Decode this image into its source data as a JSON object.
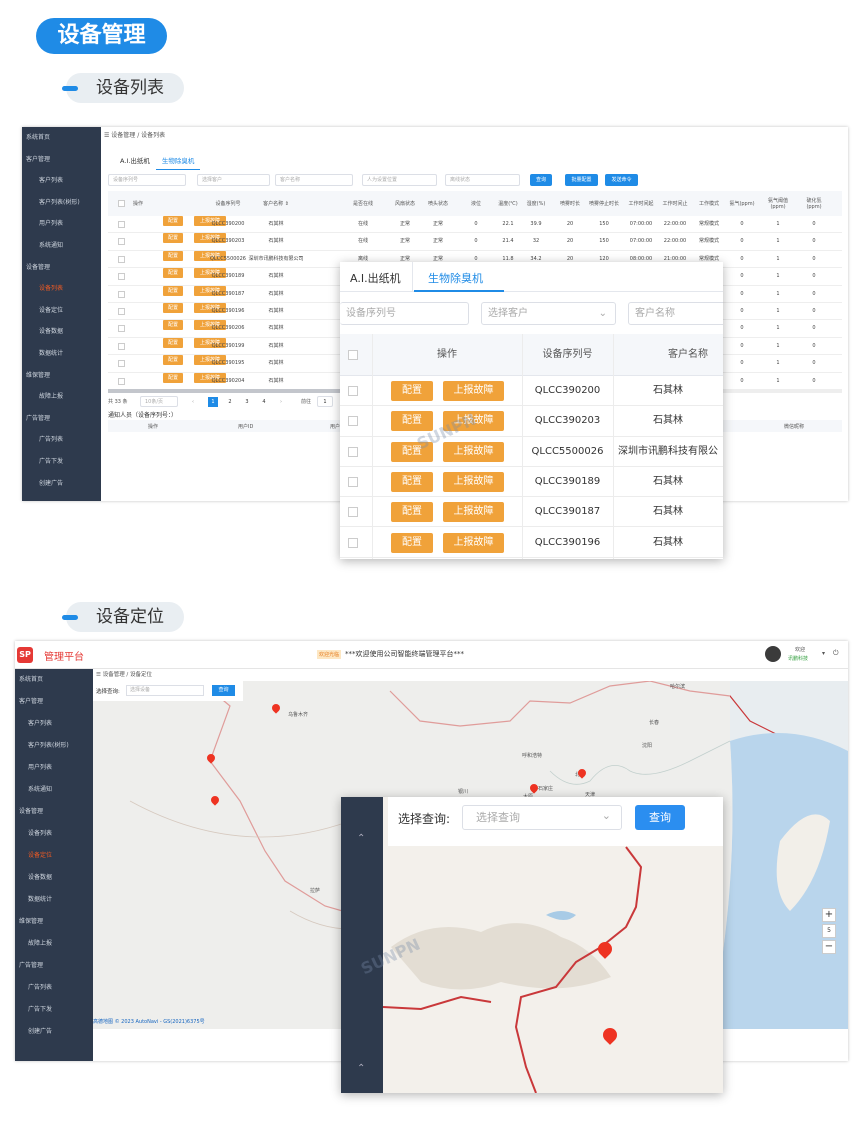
{
  "section1": {
    "title": "设备管理",
    "subtitle": "设备列表"
  },
  "section2": {
    "subtitle": "设备定位"
  },
  "sidebar1": {
    "items": [
      {
        "label": "系统首页",
        "sub": false,
        "active": false
      },
      {
        "label": "客户管理",
        "sub": false,
        "active": false
      },
      {
        "label": "客户列表",
        "sub": true,
        "active": false
      },
      {
        "label": "客户列表(树形)",
        "sub": true,
        "active": false
      },
      {
        "label": "用户列表",
        "sub": true,
        "active": false
      },
      {
        "label": "系统通知",
        "sub": true,
        "active": false
      },
      {
        "label": "设备管理",
        "sub": false,
        "active": false
      },
      {
        "label": "设备列表",
        "sub": true,
        "active": true
      },
      {
        "label": "设备定位",
        "sub": true,
        "active": false
      },
      {
        "label": "设备数据",
        "sub": true,
        "active": false
      },
      {
        "label": "数据统计",
        "sub": true,
        "active": false
      },
      {
        "label": "维保管理",
        "sub": false,
        "active": false
      },
      {
        "label": "故障上报",
        "sub": true,
        "active": false
      },
      {
        "label": "广告管理",
        "sub": false,
        "active": false
      },
      {
        "label": "广告列表",
        "sub": true,
        "active": false
      },
      {
        "label": "广告下发",
        "sub": true,
        "active": false
      },
      {
        "label": "创建广告",
        "sub": true,
        "active": false
      }
    ]
  },
  "list": {
    "breadcrumb": "设备管理  /  设备列表",
    "tabs": [
      "A.I.出纸机",
      "生物除臭机"
    ],
    "filters": {
      "serial": "设备序列号",
      "customer": "选择客户",
      "customer_name": "客户名称",
      "location": "人为设置位置",
      "status": "离线状态"
    },
    "buttons": {
      "query": "查询",
      "batch": "批量配置",
      "send": "发送命令"
    },
    "columns": [
      "操作",
      "设备序列号",
      "客户名称 ⇕",
      "是否在线",
      "风扇状态",
      "喷头状态",
      "液位",
      "温度(℃)",
      "湿度(%)",
      "喷雾时长",
      "喷雾停止时长",
      "工作时间起",
      "工作时间止",
      "工作模式",
      "氨气(ppm)",
      "氨气阈值(ppm)",
      "硫化氢(ppm)"
    ],
    "op_config": "配置",
    "op_report": "上报故障",
    "rows": [
      [
        "QLCC390200",
        "石其林",
        "在线",
        "正常",
        "正常",
        "0",
        "22.1",
        "39.9",
        "20",
        "150",
        "07:00:00",
        "22:00:00",
        "常规模式",
        "0",
        "1",
        "0"
      ],
      [
        "QLCC390203",
        "石其林",
        "在线",
        "正常",
        "正常",
        "0",
        "21.4",
        "32",
        "20",
        "150",
        "07:00:00",
        "22:00:00",
        "常规模式",
        "0",
        "1",
        "0"
      ],
      [
        "QLCC5500026",
        "深圳市讯鹏科技有限公司",
        "离线",
        "正常",
        "正常",
        "0",
        "11.8",
        "34.2",
        "20",
        "120",
        "08:00:00",
        "21:00:00",
        "常规模式",
        "0",
        "1",
        "0"
      ],
      [
        "QLCC390189",
        "石其林",
        "",
        "",
        "",
        "",
        "",
        "",
        "",
        "",
        "",
        "",
        "",
        "0",
        "1",
        "0"
      ],
      [
        "QLCC390187",
        "石其林",
        "",
        "",
        "",
        "",
        "",
        "",
        "",
        "",
        "",
        "",
        "",
        "0",
        "1",
        "0"
      ],
      [
        "QLCC390196",
        "石其林",
        "",
        "",
        "",
        "",
        "",
        "",
        "",
        "",
        "",
        "",
        "",
        "0",
        "1",
        "0"
      ],
      [
        "QLCC390206",
        "石其林",
        "",
        "",
        "",
        "",
        "",
        "",
        "",
        "",
        "",
        "",
        "",
        "0",
        "1",
        "0"
      ],
      [
        "QLCC390199",
        "石其林",
        "",
        "",
        "",
        "",
        "",
        "",
        "",
        "",
        "",
        "",
        "",
        "0",
        "1",
        "0"
      ],
      [
        "QLCC390195",
        "石其林",
        "",
        "",
        "",
        "",
        "",
        "",
        "",
        "",
        "",
        "",
        "",
        "0",
        "1",
        "0"
      ],
      [
        "QLCC390204",
        "石其林",
        "",
        "",
        "",
        "",
        "",
        "",
        "",
        "",
        "",
        "",
        "",
        "0",
        "1",
        "0"
      ]
    ],
    "pagination": {
      "total": "共 33 条",
      "size": "10条/页",
      "pages": [
        "1",
        "2",
        "3",
        "4"
      ],
      "goto": "前往",
      "current": "1"
    },
    "notice": "通知人员（设备序列号：）",
    "notice_columns": [
      "操作",
      "用户ID",
      "用户",
      "微信昵称"
    ]
  },
  "popup1": {
    "tabs": [
      "A.I.出纸机",
      "生物除臭机"
    ],
    "filters": {
      "serial": "设备序列号",
      "customer": "选择客户",
      "customer_name": "客户名称"
    },
    "columns": {
      "op": "操作",
      "serial": "设备序列号",
      "customer": "客户名称"
    },
    "op_config": "配置",
    "op_report": "上报故障",
    "rows": [
      {
        "serial": "QLCC390200",
        "customer": "石其林"
      },
      {
        "serial": "QLCC390203",
        "customer": "石其林"
      },
      {
        "serial": "QLCC5500026",
        "customer": "深圳市讯鹏科技有限公"
      },
      {
        "serial": "QLCC390189",
        "customer": "石其林"
      },
      {
        "serial": "QLCC390187",
        "customer": "石其林"
      },
      {
        "serial": "QLCC390196",
        "customer": "石其林"
      }
    ]
  },
  "locate": {
    "app_name": "管理平台",
    "logo_text": "SP",
    "marquee_tag": "欢迎光临",
    "marquee": "***欢迎使用公司智能终端管理平台***",
    "welcome": "欢迎",
    "user": "讯鹏科技",
    "breadcrumb": "设备管理  /  设备定位",
    "query_label": "选择查询:",
    "query_placeholder": "选择设备",
    "query_button": "查询",
    "map_credit": "高德地图  © 2023 AutoNavi - GS(2021)6375号",
    "cities": [
      "哈尔滨",
      "长春",
      "乌鲁木齐",
      "沈阳",
      "呼和浩特",
      "北京",
      "天津",
      "太原",
      "石家庄",
      "银川",
      "拉萨"
    ],
    "zoom_level": "5"
  },
  "sidebar2": {
    "items": [
      {
        "label": "系统首页",
        "sub": false,
        "active": false
      },
      {
        "label": "客户管理",
        "sub": false,
        "active": false
      },
      {
        "label": "客户列表",
        "sub": true,
        "active": false
      },
      {
        "label": "客户列表(树形)",
        "sub": true,
        "active": false
      },
      {
        "label": "用户列表",
        "sub": true,
        "active": false
      },
      {
        "label": "系统通知",
        "sub": true,
        "active": false
      },
      {
        "label": "设备管理",
        "sub": false,
        "active": false
      },
      {
        "label": "设备列表",
        "sub": true,
        "active": false
      },
      {
        "label": "设备定位",
        "sub": true,
        "active": true
      },
      {
        "label": "设备数据",
        "sub": true,
        "active": false
      },
      {
        "label": "数据统计",
        "sub": true,
        "active": false
      },
      {
        "label": "维保管理",
        "sub": false,
        "active": false
      },
      {
        "label": "故障上报",
        "sub": true,
        "active": false
      },
      {
        "label": "广告管理",
        "sub": false,
        "active": false
      },
      {
        "label": "广告列表",
        "sub": true,
        "active": false
      },
      {
        "label": "广告下发",
        "sub": true,
        "active": false
      },
      {
        "label": "创建广告",
        "sub": true,
        "active": false
      }
    ]
  },
  "popup2": {
    "query_label": "选择查询:",
    "query_placeholder": "选择查询",
    "query_button": "查询"
  },
  "watermark": "SUNPN"
}
